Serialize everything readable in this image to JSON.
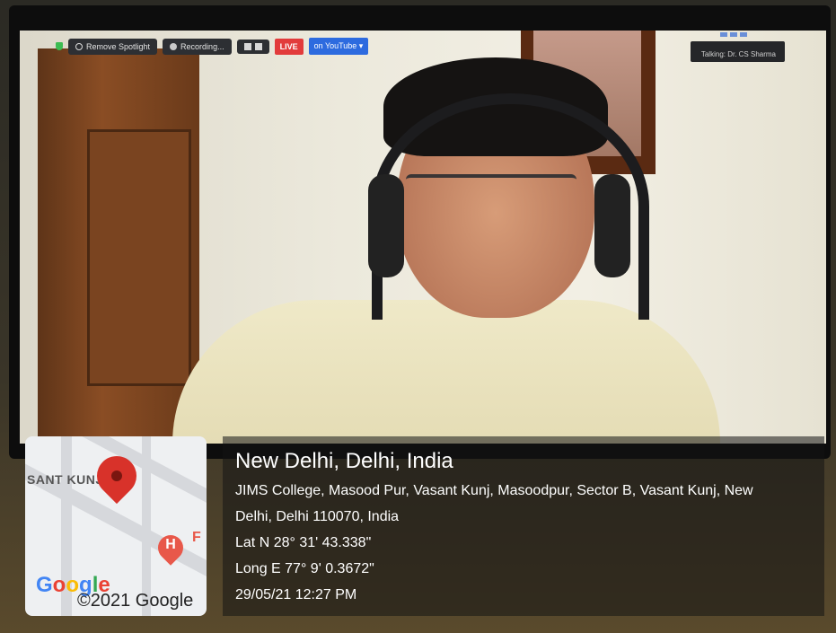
{
  "zoom_bar": {
    "remove_spotlight": "Remove Spotlight",
    "recording": "Recording...",
    "live": "LIVE",
    "youtube": "on YouTube ▾"
  },
  "speaker": {
    "talking": "Talking: Dr. CS Sharma"
  },
  "map": {
    "street": "SANT KUNJ",
    "hospital_letter": "H",
    "fragment": "F",
    "google": [
      "G",
      "o",
      "o",
      "g",
      "l",
      "e"
    ],
    "copyright": "©2021 Google"
  },
  "location": {
    "city": "New Delhi, Delhi, India",
    "address_line1": "JIMS College, Masood Pur, Vasant Kunj, Masoodpur, Sector B, Vasant Kunj, New",
    "address_line2": "Delhi, Delhi 110070, India",
    "lat": "Lat N 28° 31' 43.338\"",
    "long": "Long E 77° 9' 0.3672\"",
    "timestamp": "29/05/21 12:27 PM"
  },
  "colors": {
    "live_red": "#e23b3b",
    "pin_red": "#d8322a",
    "youtube_blue": "#2d6bdf"
  }
}
